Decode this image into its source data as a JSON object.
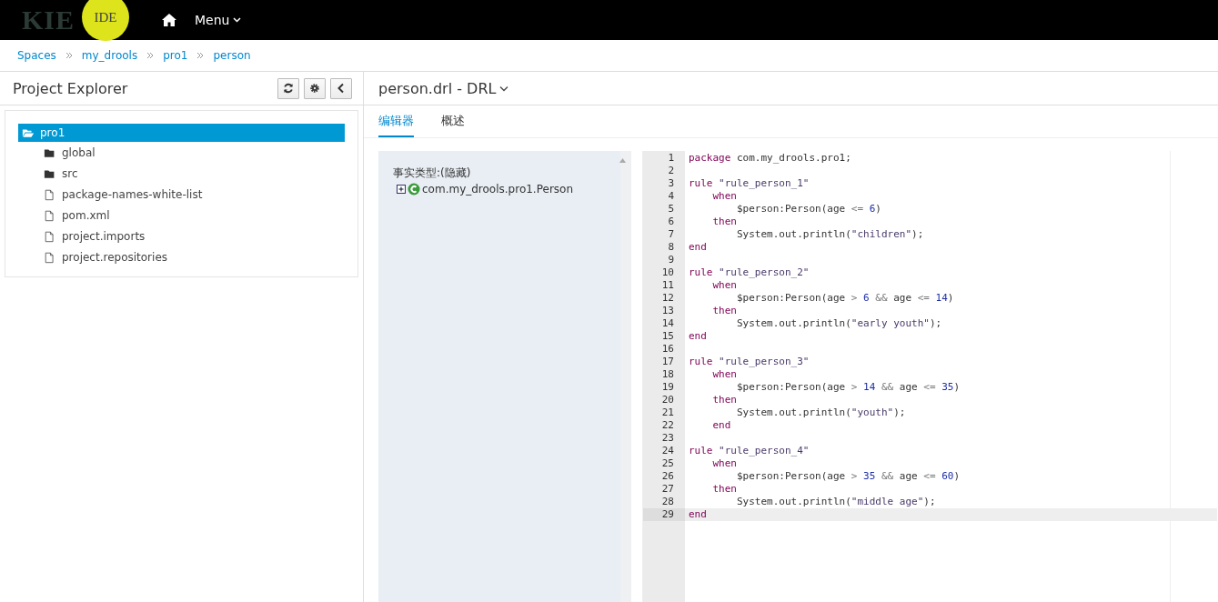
{
  "navbar": {
    "logo_text": "KIE",
    "logo_badge": "IDE",
    "menu_label": "Menu"
  },
  "breadcrumbs": [
    "Spaces",
    "my_drools",
    "pro1",
    "person"
  ],
  "project_explorer": {
    "title": "Project Explorer",
    "tree": [
      {
        "label": "pro1",
        "kind": "folder",
        "selected": true,
        "expanded": true,
        "children": [
          {
            "label": "global",
            "kind": "folder",
            "selected": false,
            "expanded": false
          },
          {
            "label": "src",
            "kind": "folder",
            "selected": false,
            "expanded": false
          },
          {
            "label": "package-names-white-list",
            "kind": "file",
            "selected": false
          },
          {
            "label": "pom.xml",
            "kind": "file",
            "selected": false
          },
          {
            "label": "project.imports",
            "kind": "file",
            "selected": false
          },
          {
            "label": "project.repositories",
            "kind": "file",
            "selected": false
          }
        ]
      }
    ]
  },
  "editor": {
    "title": "person.drl - DRL",
    "tabs": [
      {
        "label": "编辑器",
        "selected": true
      },
      {
        "label": "概述",
        "selected": false
      }
    ],
    "fact_types": {
      "heading": "事实类型:(隐藏)",
      "items": [
        {
          "label": "com.my_drools.pro1.Person",
          "expanded": false
        }
      ]
    },
    "code_lines": [
      {
        "number": "1",
        "current": false,
        "tokens": [
          {
            "kind": "keyword",
            "text": "package"
          },
          {
            "kind": "plain",
            "text": " com.my_drools.pro1;"
          }
        ]
      },
      {
        "number": "2",
        "current": false
      },
      {
        "number": "3",
        "current": false,
        "tokens": [
          {
            "kind": "keyword",
            "text": "rule"
          },
          {
            "kind": "string",
            "text": " \"rule_person_1\""
          }
        ]
      },
      {
        "number": "4",
        "current": false,
        "tokens": [
          {
            "kind": "keyword",
            "text": "    when"
          }
        ]
      },
      {
        "number": "5",
        "current": false,
        "tokens": [
          {
            "kind": "plain",
            "text": "        $person:Person(age "
          },
          {
            "kind": "operator",
            "text": "<="
          },
          {
            "kind": "number",
            "text": " 6"
          },
          {
            "kind": "plain",
            "text": ")"
          }
        ]
      },
      {
        "number": "6",
        "current": false,
        "tokens": [
          {
            "kind": "keyword",
            "text": "    then"
          }
        ]
      },
      {
        "number": "7",
        "current": false,
        "tokens": [
          {
            "kind": "plain",
            "text": "        System.out.println("
          },
          {
            "kind": "string",
            "text": "\"children\""
          },
          {
            "kind": "plain",
            "text": ");"
          }
        ]
      },
      {
        "number": "8",
        "current": false,
        "tokens": [
          {
            "kind": "keyword",
            "text": "end"
          }
        ]
      },
      {
        "number": "9",
        "current": false
      },
      {
        "number": "10",
        "current": false,
        "tokens": [
          {
            "kind": "keyword",
            "text": "rule"
          },
          {
            "kind": "string",
            "text": " \"rule_person_2\""
          }
        ]
      },
      {
        "number": "11",
        "current": false,
        "tokens": [
          {
            "kind": "keyword",
            "text": "    when"
          }
        ]
      },
      {
        "number": "12",
        "current": false,
        "tokens": [
          {
            "kind": "plain",
            "text": "        $person:Person(age "
          },
          {
            "kind": "operator",
            "text": ">"
          },
          {
            "kind": "number",
            "text": " 6"
          },
          {
            "kind": "operator",
            "text": " &&"
          },
          {
            "kind": "plain",
            "text": " age "
          },
          {
            "kind": "operator",
            "text": "<="
          },
          {
            "kind": "number",
            "text": " 14"
          },
          {
            "kind": "plain",
            "text": ")"
          }
        ]
      },
      {
        "number": "13",
        "current": false,
        "tokens": [
          {
            "kind": "keyword",
            "text": "    then"
          }
        ]
      },
      {
        "number": "14",
        "current": false,
        "tokens": [
          {
            "kind": "plain",
            "text": "        System.out.println("
          },
          {
            "kind": "string",
            "text": "\"early youth\""
          },
          {
            "kind": "plain",
            "text": ");"
          }
        ]
      },
      {
        "number": "15",
        "current": false,
        "tokens": [
          {
            "kind": "keyword",
            "text": "end"
          }
        ]
      },
      {
        "number": "16",
        "current": false
      },
      {
        "number": "17",
        "current": false,
        "tokens": [
          {
            "kind": "keyword",
            "text": "rule"
          },
          {
            "kind": "string",
            "text": " \"rule_person_3\""
          }
        ]
      },
      {
        "number": "18",
        "current": false,
        "tokens": [
          {
            "kind": "keyword",
            "text": "    when"
          }
        ]
      },
      {
        "number": "19",
        "current": false,
        "tokens": [
          {
            "kind": "plain",
            "text": "        $person:Person(age "
          },
          {
            "kind": "operator",
            "text": ">"
          },
          {
            "kind": "number",
            "text": " 14"
          },
          {
            "kind": "operator",
            "text": " &&"
          },
          {
            "kind": "plain",
            "text": " age "
          },
          {
            "kind": "operator",
            "text": "<="
          },
          {
            "kind": "number",
            "text": " 35"
          },
          {
            "kind": "plain",
            "text": ")"
          }
        ]
      },
      {
        "number": "20",
        "current": false,
        "tokens": [
          {
            "kind": "keyword",
            "text": "    then"
          }
        ]
      },
      {
        "number": "21",
        "current": false,
        "tokens": [
          {
            "kind": "plain",
            "text": "        System.out.println("
          },
          {
            "kind": "string",
            "text": "\"youth\""
          },
          {
            "kind": "plain",
            "text": ");"
          }
        ]
      },
      {
        "number": "22",
        "current": false,
        "tokens": [
          {
            "kind": "keyword",
            "text": "    end"
          }
        ]
      },
      {
        "number": "23",
        "current": false
      },
      {
        "number": "24",
        "current": false,
        "tokens": [
          {
            "kind": "keyword",
            "text": "rule"
          },
          {
            "kind": "string",
            "text": " \"rule_person_4\""
          }
        ]
      },
      {
        "number": "25",
        "current": false,
        "tokens": [
          {
            "kind": "keyword",
            "text": "    when"
          }
        ]
      },
      {
        "number": "26",
        "current": false,
        "tokens": [
          {
            "kind": "plain",
            "text": "        $person:Person(age "
          },
          {
            "kind": "operator",
            "text": ">"
          },
          {
            "kind": "number",
            "text": " 35"
          },
          {
            "kind": "operator",
            "text": " &&"
          },
          {
            "kind": "plain",
            "text": " age "
          },
          {
            "kind": "operator",
            "text": "<="
          },
          {
            "kind": "number",
            "text": " 60"
          },
          {
            "kind": "plain",
            "text": ")"
          }
        ]
      },
      {
        "number": "27",
        "current": false,
        "tokens": [
          {
            "kind": "keyword",
            "text": "    then"
          }
        ]
      },
      {
        "number": "28",
        "current": false,
        "tokens": [
          {
            "kind": "plain",
            "text": "        System.out.println("
          },
          {
            "kind": "string",
            "text": "\"middle age\""
          },
          {
            "kind": "plain",
            "text": ");"
          }
        ]
      },
      {
        "number": "29",
        "current": true,
        "tokens": [
          {
            "kind": "keyword",
            "text": "end"
          }
        ]
      }
    ]
  }
}
